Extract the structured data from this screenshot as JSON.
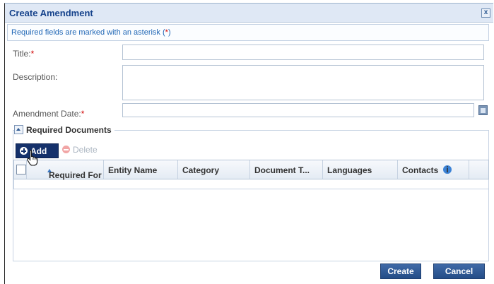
{
  "dialog": {
    "title": "Create Amendment",
    "close_glyph": "x",
    "notice_prefix": "Required fields are marked with an asterisk (",
    "notice_asterisk": "*",
    "notice_suffix": ")"
  },
  "form": {
    "title_label": "Title:",
    "description_label": "Description:",
    "amendment_date_label": "Amendment Date:",
    "required_marker": "*",
    "title_value": "",
    "description_value": "",
    "amendment_date_value": ""
  },
  "documents": {
    "section_title": "Required Documents",
    "add_label": "Add",
    "delete_label": "Delete",
    "columns": [
      "Required For",
      "Entity Name",
      "Category",
      "Document T...",
      "Languages",
      "Contacts"
    ],
    "rows": []
  },
  "footer": {
    "create_label": "Create",
    "cancel_label": "Cancel"
  },
  "colors": {
    "accent": "#15316b",
    "required": "#d10000",
    "link_text": "#1f66b5"
  }
}
